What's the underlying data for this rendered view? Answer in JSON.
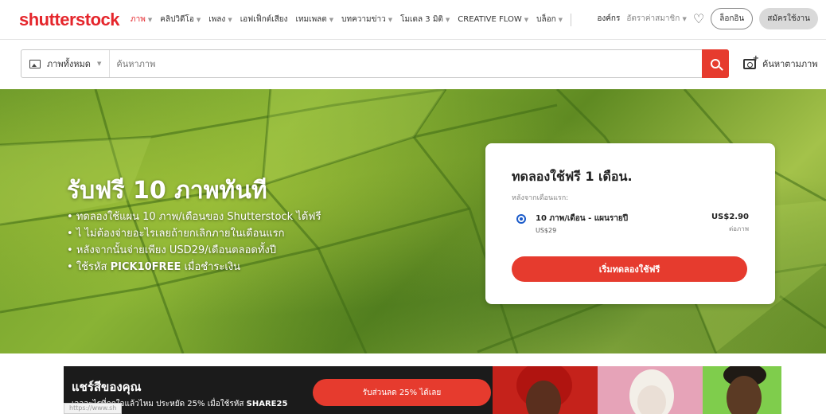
{
  "brand": {
    "logo": "shutterstock",
    "accent": "#e5262c",
    "cta_color": "#e63b2e"
  },
  "nav": {
    "items": [
      {
        "label": "ภาพ",
        "dropdown": true,
        "active": true
      },
      {
        "label": "คลิปวิดีโอ",
        "dropdown": true
      },
      {
        "label": "เพลง",
        "dropdown": true
      },
      {
        "label": "เอฟเฟ็กต์เสียง",
        "dropdown": false
      },
      {
        "label": "เทมเพลต",
        "dropdown": true
      },
      {
        "label": "บทความข่าว",
        "dropdown": true
      },
      {
        "label": "โมเดล 3 มิติ",
        "dropdown": true
      },
      {
        "label": "CREATIVE FLOW",
        "dropdown": true
      },
      {
        "label": "บล็อก",
        "dropdown": true
      }
    ],
    "enterprise": "องค์กร",
    "pricing": "อัตราค่าสมาชิก",
    "favorites_icon": "heart-icon",
    "login": "ล็อกอิน",
    "signup": "สมัครใช้งาน"
  },
  "search": {
    "filter_label": "ภาพทั้งหมด",
    "filter_icon": "image-icon",
    "placeholder": "ค้นหาภาพ",
    "value": "",
    "search_icon": "search-icon",
    "visual_search_label": "ค้นหาตามภาพ",
    "visual_search_icon": "camera-plus-icon"
  },
  "hero": {
    "title": "รับฟรี 10 ภาพทันที",
    "bullets": [
      "ทดลองใช้แผน 10 ภาพ/เดือนของ Shutterstock ได้ฟรี",
      "ไ ไม่ต้องจ่ายอะไรเลยถ้ายกเลิกภายในเดือนแรก",
      "หลังจากนั้นจ่ายเพียง USD29/เดือนตลอดทั้งปี"
    ],
    "code_prefix": "ใช้รหัส ",
    "code": "PICK10FREE",
    "code_suffix": " เมื่อชำระเงิน"
  },
  "trial_card": {
    "title": "ทดลองใช้ฟรี 1 เดือน.",
    "subtitle": "หลังจากเดือนแรก:",
    "plan": {
      "name": "10 ภาพ/เดือน - แผนรายปี",
      "monthly": "US$29",
      "price": "US$2.90",
      "price_unit": "ต่อภาพ",
      "selected": true
    },
    "cta": "เริ่มทดลองใช้ฟรี"
  },
  "promo": {
    "title": "แชร์สีของคุณ",
    "text_prefix": "เจออะไรที่ถูกใจแล้วไหม ประหยัด 25% เมื่อใช้รหัส ",
    "code": "SHARE25",
    "button": "รับส่วนลด 25% ได้เลย"
  },
  "status_url": "https://www.sh"
}
